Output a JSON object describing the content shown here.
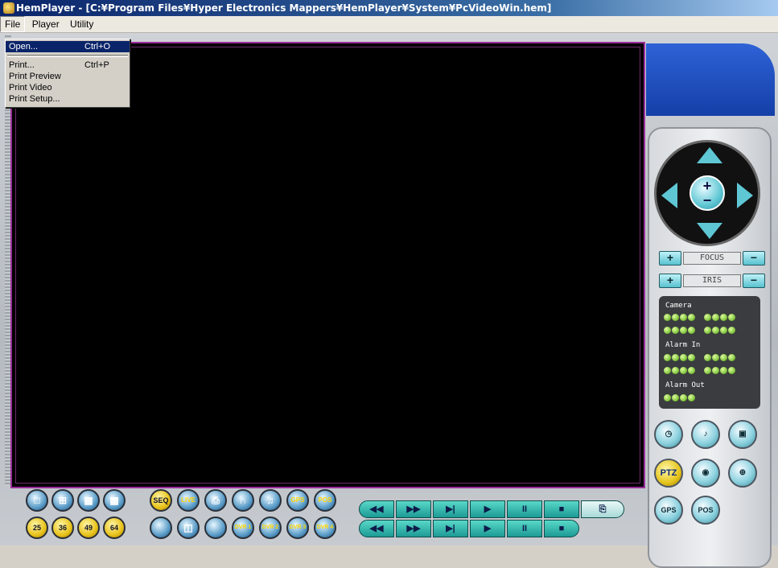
{
  "window": {
    "title": "HemPlayer - [C:¥Program Files¥Hyper Electronics Mappers¥HemPlayer¥System¥PcVideoWin.hem]"
  },
  "menubar": {
    "items": [
      {
        "label": "File"
      },
      {
        "label": "Player"
      },
      {
        "label": "Utility"
      }
    ]
  },
  "file_menu": {
    "open": {
      "label": "Open...",
      "shortcut": "Ctrl+O"
    },
    "print": {
      "label": "Print...",
      "shortcut": "Ctrl+P"
    },
    "print_preview": {
      "label": "Print Preview"
    },
    "print_video": {
      "label": "Print Video"
    },
    "print_setup": {
      "label": "Print Setup..."
    }
  },
  "ptz_panel": {
    "zoom_plus": "+",
    "zoom_minus": "−",
    "focus": {
      "plus": "+",
      "label": "FOCUS",
      "minus": "−"
    },
    "iris": {
      "plus": "+",
      "label": "IRIS",
      "minus": "−"
    }
  },
  "status_panel": {
    "camera_label": "Camera",
    "alarm_in_label": "Alarm In",
    "alarm_out_label": "Alarm Out"
  },
  "right_buttons": {
    "ptz": "PTZ",
    "gps": "GPS",
    "pos": "POS"
  },
  "bottom_toolbar": {
    "seq": "SEQ",
    "live": "LIVE",
    "gps": "GPS",
    "pos": "POS",
    "split_25": "25",
    "split_36": "36",
    "split_49": "49",
    "split_64": "64",
    "dvr1": "DVR 1",
    "dvr2": "DVR 2",
    "dvr3": "DVR 3",
    "dvr4": "DVR 4"
  },
  "playback": {
    "rewind": "◀◀",
    "fast_forward": "▶▶",
    "step": "▶|",
    "play": "▶",
    "pause": "II",
    "stop": "■"
  },
  "colors": {
    "accent_teal": "#5fc7d4",
    "video_border": "#9a2d9a",
    "status_green": "#7fc43a"
  }
}
